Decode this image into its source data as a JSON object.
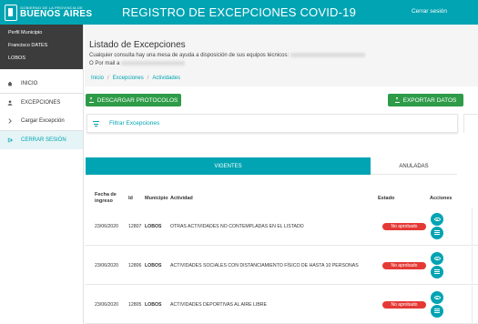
{
  "header": {
    "logo_small": "GOBIERNO DE LA PROVINCIA DE",
    "logo_big": "BUENOS AIRES",
    "title": "REGISTRO DE EXCEPCIONES COVID-19",
    "logout": "Cerrar sesión"
  },
  "sidebar": {
    "profile_lines": [
      "Perfil Municipio",
      "Francisco DATES",
      "LOBOS"
    ],
    "items": [
      {
        "label": "INICIO",
        "icon": "home-icon"
      },
      {
        "label": "EXCEPCIONES",
        "icon": "user-icon"
      },
      {
        "label": "Cargar Excepción",
        "icon": "chevron-right-icon"
      },
      {
        "label": "CERRAR SESIÓN",
        "icon": "logout-icon"
      }
    ]
  },
  "main": {
    "title": "Listado de Excepciones",
    "help_text": "Cualquier consulta hay una mesa de ayuda a disposición de sus equipos técnicos:",
    "mail_text": "O Por mail a",
    "breadcrumb": [
      "Inicio",
      "Excepciones",
      "Actividades"
    ],
    "download_button": "DESCARGAR PROTOCOLOS",
    "export_button": "EXPORTAR DATOS",
    "filter_label": "Filtrar Excepciones",
    "tabs": {
      "active": "VIGENTES",
      "inactive": "ANULADAS"
    }
  },
  "table": {
    "headers": {
      "fecha_line1": "Fecha de",
      "fecha_line2": "ingreso",
      "id": "Id",
      "municipio": "Municipio",
      "actividad": "Actividad",
      "estado": "Estado",
      "acciones": "Acciones"
    },
    "rows": [
      {
        "fecha": "23/06/2020",
        "id": "12807",
        "municipio": "LOBOS",
        "actividad": "OTRAS ACTIVIDADES NO CONTEMPLADAS EN EL LISTADO",
        "estado": "No aprobado"
      },
      {
        "fecha": "23/06/2020",
        "id": "12806",
        "municipio": "LOBOS",
        "actividad": "ACTIVIDADES SOCIALES CON DISTANCIAMIENTO FÍSICO DE HASTA 10 PERSONAS",
        "estado": "No aprobado"
      },
      {
        "fecha": "23/06/2020",
        "id": "12805",
        "municipio": "LOBOS",
        "actividad": "ACTIVIDADES DEPORTIVAS AL AIRE LIBRE",
        "estado": "No aprobado"
      }
    ]
  },
  "colors": {
    "primary": "#00a4b3",
    "green": "#2e9b48",
    "danger": "#e53935",
    "profile_bg": "#3c3c3c"
  }
}
